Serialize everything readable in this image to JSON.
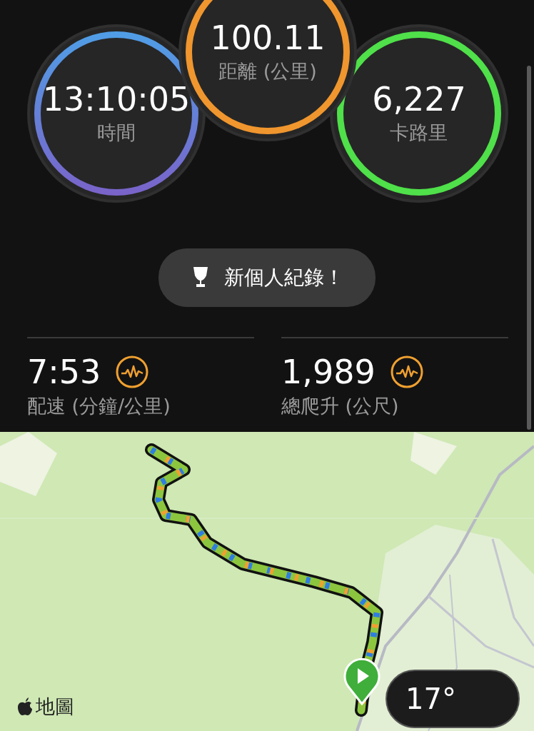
{
  "summary_rings": [
    {
      "value": "13:10:05",
      "label": "時間",
      "color": "#4f9ee6"
    },
    {
      "value": "100.11",
      "label": "距離 (公里)",
      "color": "#f0962e"
    },
    {
      "value": "6,227",
      "label": "卡路里",
      "color": "#4fe04a"
    }
  ],
  "record_badge": {
    "label": "新個人紀錄！"
  },
  "stats": [
    {
      "value": "7:53",
      "label": "配速 (分鐘/公里)"
    },
    {
      "value": "1,989",
      "label": "總爬升 (公尺)"
    }
  ],
  "map": {
    "attribution": "地圖",
    "temperature": "17°"
  }
}
